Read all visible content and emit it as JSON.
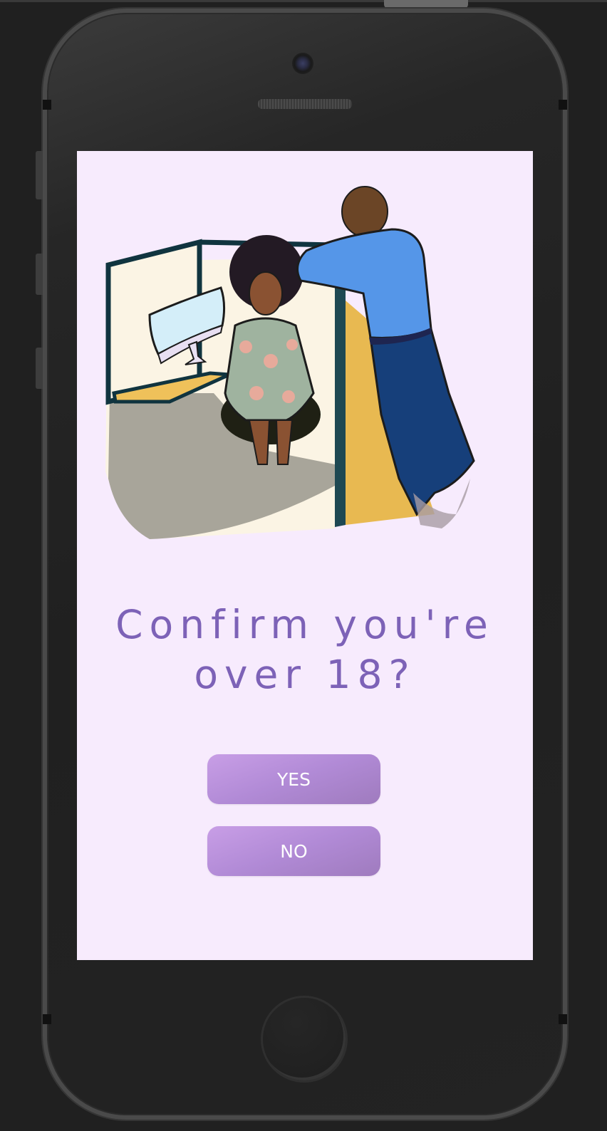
{
  "dialog": {
    "title_line1": "Confirm you're",
    "title_line2": "over 18?",
    "yes_label": "YES",
    "no_label": "NO"
  },
  "colors": {
    "screen_background": "#f7ebfd",
    "title": "#7d62b7",
    "button": "#b18ad6",
    "device_body": "#202020"
  },
  "illustration": {
    "subject": "office-cubicle-scene-icon"
  }
}
